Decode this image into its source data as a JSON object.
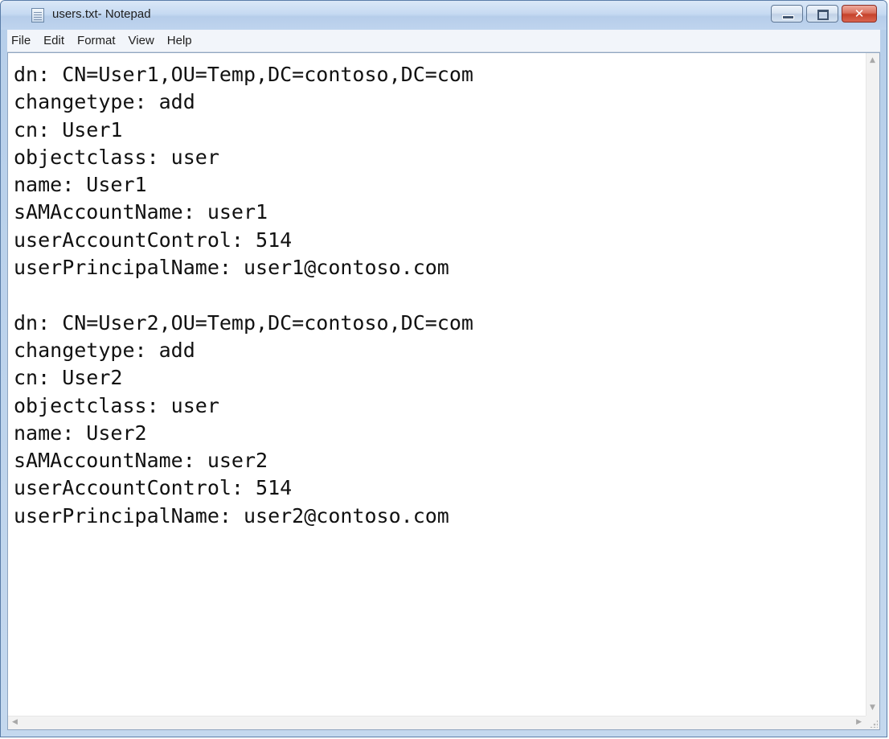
{
  "window": {
    "title": "users.txt- Notepad",
    "close_glyph": "✕"
  },
  "menu": {
    "items": [
      "File",
      "Edit",
      "Format",
      "View",
      "Help"
    ]
  },
  "editor": {
    "lines": [
      "dn: CN=User1,OU=Temp,DC=contoso,DC=com",
      "changetype: add",
      "cn: User1",
      "objectclass: user",
      "name: User1",
      "sAMAccountName: user1",
      "userAccountControl: 514",
      "userPrincipalName: user1@contoso.com",
      "",
      "dn: CN=User2,OU=Temp,DC=contoso,DC=com",
      "changetype: add",
      "cn: User2",
      "objectclass: user",
      "name: User2",
      "sAMAccountName: user2",
      "userAccountControl: 514",
      "userPrincipalName: user2@contoso.com"
    ]
  },
  "scrollbars": {
    "up_arrow": "▲",
    "down_arrow": "▼",
    "left_arrow": "◀",
    "right_arrow": "▶"
  },
  "colors": {
    "title_bar": "#c6daf2",
    "close_button": "#c6422b",
    "text": "#111111"
  }
}
